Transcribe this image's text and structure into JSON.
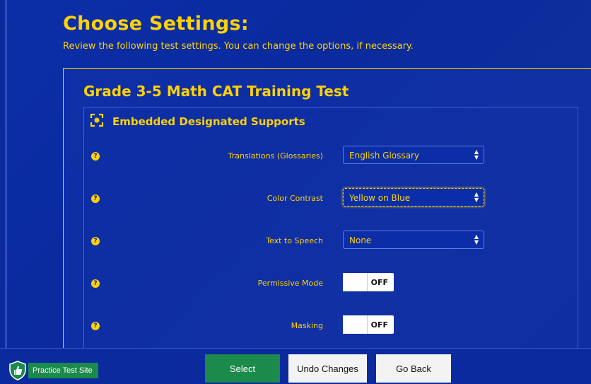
{
  "header": {
    "title": "Choose Settings:",
    "subtitle": "Review the following test settings. You can change the options, if necessary."
  },
  "panel": {
    "title": "Grade 3-5 Math CAT Training Test",
    "section_title": "Embedded Designated Supports"
  },
  "settings": [
    {
      "label": "Translations (Glossaries)",
      "type": "select",
      "value": "English Glossary",
      "focused": false
    },
    {
      "label": "Color Contrast",
      "type": "select",
      "value": "Yellow on Blue",
      "focused": true
    },
    {
      "label": "Text to Speech",
      "type": "select",
      "value": "None",
      "focused": false
    },
    {
      "label": "Permissive Mode",
      "type": "toggle",
      "value": "OFF"
    },
    {
      "label": "Masking",
      "type": "toggle",
      "value": "OFF"
    }
  ],
  "help_glyph": "?",
  "footer": {
    "brand": "Practice Test Site",
    "select_label": "Select",
    "undo_label": "Undo Changes",
    "back_label": "Go Back"
  },
  "colors": {
    "background": "#0a2a9e",
    "accent": "#ffd200",
    "primary_button": "#1b8a4a"
  },
  "icons": {
    "section": "target-focus-icon",
    "help": "help-circle-icon",
    "select": "chevron-up-down-icon",
    "brand": "shield-thumbs-up-icon"
  }
}
